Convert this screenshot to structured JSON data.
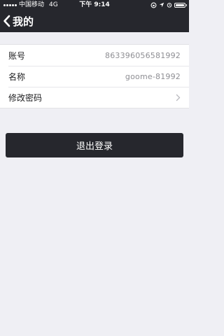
{
  "status_bar": {
    "carrier": "中国移动",
    "network": "4G",
    "time": "下午 9:14",
    "battery_level": 1.0
  },
  "nav": {
    "back_label": "我的",
    "back_icon": "chevron-left-icon"
  },
  "account_info": {
    "rows": [
      {
        "label": "账号",
        "value": "863396056581992"
      },
      {
        "label": "名称",
        "value": "goome-81992"
      },
      {
        "label": "修改密码",
        "chevron": "chevron-right-icon"
      }
    ]
  },
  "logout": {
    "label": "退出登录"
  },
  "colors": {
    "dark": "#26272d",
    "background": "#efeff4",
    "value_gray": "#8e8e93"
  }
}
